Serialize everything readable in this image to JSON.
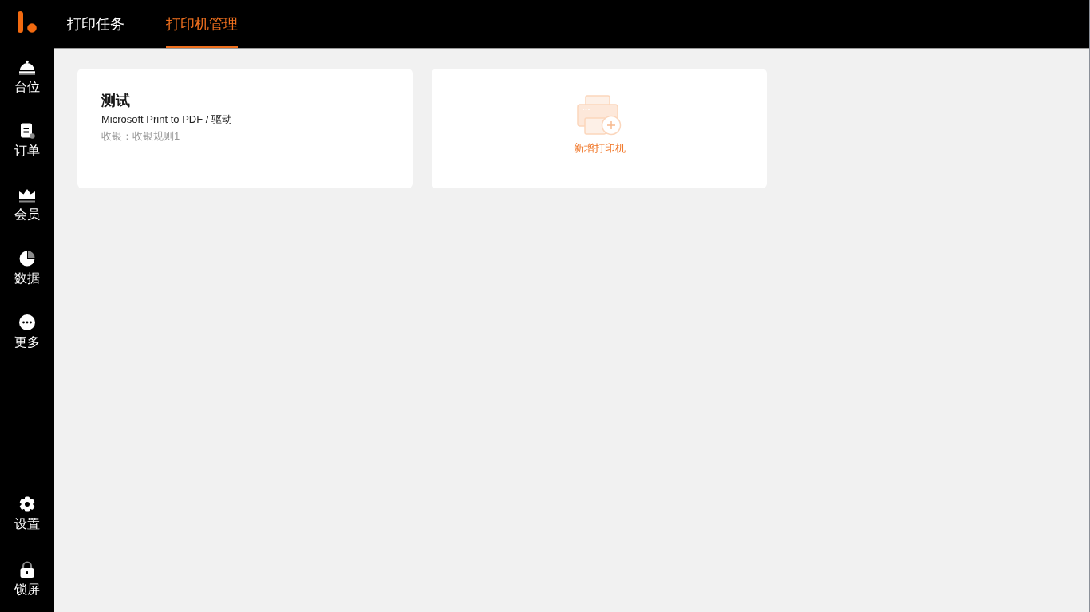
{
  "sidebar": {
    "items": [
      {
        "kind": "tables",
        "label": "台位",
        "selected": false
      },
      {
        "kind": "orders",
        "label": "订单",
        "selected": false
      },
      {
        "kind": "members",
        "label": "会员",
        "selected": false
      },
      {
        "kind": "data",
        "label": "数据",
        "selected": false
      },
      {
        "kind": "more",
        "label": "更多",
        "selected": false
      }
    ],
    "bottom_items": [
      {
        "kind": "settings",
        "label": "设置",
        "selected": false
      },
      {
        "kind": "lock",
        "label": "锁屏",
        "selected": false
      }
    ]
  },
  "tabs": [
    {
      "label": "打印任务",
      "selected": false
    },
    {
      "label": "打印机管理",
      "selected": true
    }
  ],
  "printers": [
    {
      "name": "测试",
      "driver": "Microsoft Print to PDF / 驱动",
      "rule": "收银：收银规则1"
    }
  ],
  "add_card": {
    "label": "新增打印机"
  }
}
